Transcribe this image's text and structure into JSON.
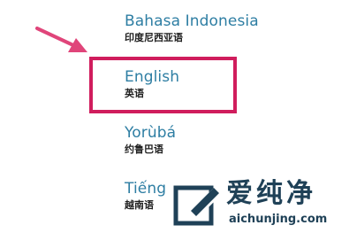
{
  "languages": [
    {
      "name": "Bahasa Indonesia",
      "native": "印度尼西亚语"
    },
    {
      "name": "English",
      "native": "英语"
    },
    {
      "name": "Yorùbá",
      "native": "约鲁巴语"
    },
    {
      "name": "Tiếng",
      "native": "越南语"
    }
  ],
  "highlight": {
    "selected": "English",
    "color": "#d01d5d"
  },
  "arrow": {
    "icon": "arrow-pointer-icon",
    "color": "#e0457a"
  },
  "watermark": {
    "title": "爱纯净",
    "url": "aichunjing.com"
  },
  "colors": {
    "language_name": "#2e7ea3",
    "native_name": "#202020",
    "watermark": "#1f4157"
  }
}
